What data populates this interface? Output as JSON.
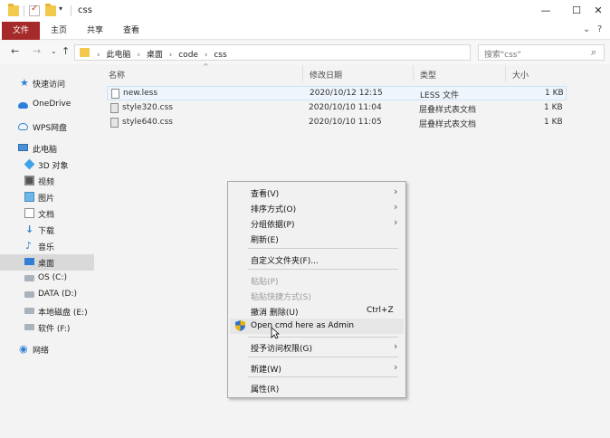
{
  "window": {
    "title": "css",
    "minimize_glyph": "—",
    "maximize_glyph": "☐",
    "close_glyph": "✕"
  },
  "ribbon": {
    "tabs": [
      {
        "label": "文件",
        "active": true
      },
      {
        "label": "主页",
        "active": false
      },
      {
        "label": "共享",
        "active": false
      },
      {
        "label": "查看",
        "active": false
      }
    ],
    "expand_glyph": "⌄",
    "help_glyph": "?"
  },
  "nav": {
    "back": "←",
    "forward": "→",
    "recent": "⌄",
    "up": "↑",
    "breadcrumbs": [
      "此电脑",
      "桌面",
      "code",
      "css"
    ],
    "crumb_separator": "›",
    "dropdown_glyph": "⌄",
    "refresh_glyph": "↻",
    "search_placeholder": "搜索\"css\"",
    "search_glyph": "⌕"
  },
  "sidebar": {
    "items": [
      {
        "label": "快速访问",
        "icon": "star-icon"
      },
      {
        "label": "OneDrive",
        "icon": "cloud-icon"
      },
      {
        "label": "WPS网盘",
        "icon": "wps-cloud-icon"
      },
      {
        "label": "此电脑",
        "icon": "computer-icon"
      },
      {
        "label": "3D 对象",
        "icon": "3d-objects-icon"
      },
      {
        "label": "视频",
        "icon": "video-icon"
      },
      {
        "label": "图片",
        "icon": "picture-icon"
      },
      {
        "label": "文档",
        "icon": "document-icon"
      },
      {
        "label": "下载",
        "icon": "download-icon"
      },
      {
        "label": "音乐",
        "icon": "music-icon"
      },
      {
        "label": "桌面",
        "icon": "desktop-icon",
        "selected": true
      },
      {
        "label": "OS (C:)",
        "icon": "drive-icon"
      },
      {
        "label": "DATA (D:)",
        "icon": "drive-icon"
      },
      {
        "label": "本地磁盘 (E:)",
        "icon": "drive-icon"
      },
      {
        "label": "软件 (F:)",
        "icon": "drive-icon"
      },
      {
        "label": "网络",
        "icon": "network-icon"
      }
    ],
    "glyphs": {
      "star": "★",
      "down": "↓",
      "music": "♪",
      "network": "◉"
    }
  },
  "filelist": {
    "columns": [
      "名称",
      "修改日期",
      "类型",
      "大小"
    ],
    "sort_glyph": "^",
    "rows": [
      {
        "name": "new.less",
        "date": "2020/10/12 12:15",
        "type": "LESS 文件",
        "size": "1 KB",
        "selected": true
      },
      {
        "name": "style320.css",
        "date": "2020/10/10 11:04",
        "type": "层叠样式表文档",
        "size": "1 KB"
      },
      {
        "name": "style640.css",
        "date": "2020/10/10 11:05",
        "type": "层叠样式表文档",
        "size": "1 KB"
      }
    ]
  },
  "context_menu": {
    "items": [
      {
        "label": "查看(V)",
        "submenu": true
      },
      {
        "label": "排序方式(O)",
        "submenu": true
      },
      {
        "label": "分组依据(P)",
        "submenu": true
      },
      {
        "label": "刷新(E)"
      },
      {
        "separator": true
      },
      {
        "label": "自定义文件夹(F)..."
      },
      {
        "separator": true
      },
      {
        "label": "粘贴(P)",
        "disabled": true
      },
      {
        "label": "粘贴快捷方式(S)",
        "disabled": true
      },
      {
        "label": "撤消 删除(U)",
        "shortcut": "Ctrl+Z"
      },
      {
        "label": "Open cmd here as Admin",
        "icon": "shield-icon",
        "hover": true
      },
      {
        "separator": true
      },
      {
        "label": "授予访问权限(G)",
        "submenu": true
      },
      {
        "separator": true
      },
      {
        "label": "新建(W)",
        "submenu": true
      },
      {
        "separator": true
      },
      {
        "label": "属性(R)"
      }
    ],
    "submenu_glyph": "›"
  }
}
